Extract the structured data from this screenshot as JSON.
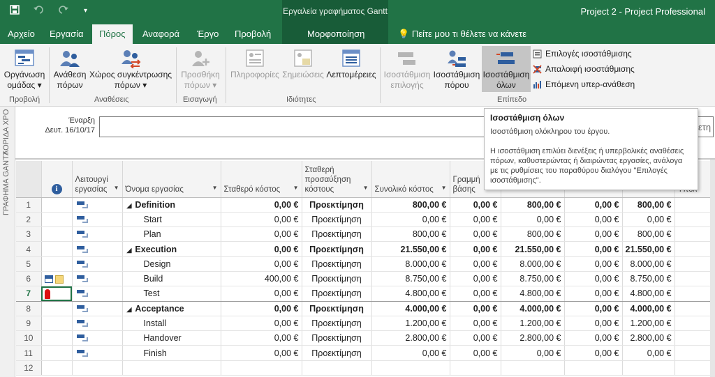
{
  "titlebar": {
    "context_title": "Εργαλεία γραφήματος Gantt",
    "app_title": "Project 2  -  Project Professional",
    "save_icon": "save-icon",
    "undo_icon": "undo-icon",
    "redo_icon": "redo-icon",
    "qat_more": "▾"
  },
  "tabs": {
    "file": "Αρχείο",
    "task": "Εργασία",
    "resource": "Πόρος",
    "report": "Αναφορά",
    "project": "Έργο",
    "view": "Προβολή",
    "format": "Μορφοποίηση",
    "tellme": "Πείτε μου τι θέλετε να κάνετε"
  },
  "ribbon": {
    "team_planner": [
      "Οργάνωση",
      "ομάδας ▾"
    ],
    "assign_resources": [
      "Ανάθεση",
      "πόρων"
    ],
    "resource_pool": [
      "Χώρος συγκέντρωσης",
      "πόρων ▾"
    ],
    "add_resources": [
      "Προσθήκη",
      "πόρων ▾"
    ],
    "information": "Πληροφορίες",
    "notes": "Σημειώσεις",
    "details": "Λεπτομέρειες",
    "level_selection": [
      "Ισοστάθμιση",
      "επιλογής"
    ],
    "level_resource": [
      "Ισοστάθμιση",
      "πόρου"
    ],
    "level_all": [
      "Ισοστάθμιση",
      "όλων"
    ],
    "leveling_options": "Επιλογές ισοστάθμισης",
    "clear_leveling": "Απαλοιφή ισοστάθμισης",
    "next_overallocation": "Επόμενη υπερ-ανάθεση",
    "groups": {
      "view": "Προβολή",
      "assignments": "Αναθέσεις",
      "insert": "Εισαγωγή",
      "properties": "Ιδιότητες",
      "level": "Επίπεδο"
    }
  },
  "timeline": {
    "side_label": "ΛΟΡΙΔΑ ΧΡΟ",
    "start_label": "Έναρξη",
    "start_date": "Δευτ. 16/10/17",
    "right_fragment": "ετη"
  },
  "tooltip": {
    "title": "Ισοστάθμιση όλων",
    "line1": "Ισοστάθμιση ολόκληρου του έργου.",
    "line2": "Η ισοστάθμιση επιλύει διενέξεις ή υπερβολικές αναθέσεις πόρων, καθυστερώντας ή διαιρώντας εργασίες, ανάλογα με τις ρυθμίσεις του παραθύρου διαλόγου \"Επιλογές ισοστάθμισης\"."
  },
  "grid": {
    "side_label": "ΓΡΑΦΗΜΑ GANTT",
    "headers": {
      "info": "i",
      "mode": "Λειτουργί εργασίας",
      "name": "Όνομα εργασίας",
      "fixed_cost": "Σταθερό κόστος",
      "accrual": "Σταθερή προσαύξηση κόστους",
      "total": "Συνολικό κόστος",
      "baseline": "Γραμμή βάσης",
      "col8": "",
      "col9": "",
      "col10": "",
      "col11": "",
      "col12": "Υπόλ"
    },
    "rows": [
      {
        "id": "1",
        "name": "Definition",
        "summary": true,
        "fixed": "0,00 €",
        "accrual": "Προεκτίμηση",
        "total": "800,00 €",
        "baseline": "0,00 €",
        "c8": "800,00 €",
        "c9": "0,00 €",
        "c10": "800,00 €"
      },
      {
        "id": "2",
        "name": "Start",
        "summary": false,
        "fixed": "0,00 €",
        "accrual": "Προεκτίμηση",
        "total": "0,00 €",
        "baseline": "0,00 €",
        "c8": "0,00 €",
        "c9": "0,00 €",
        "c10": "0,00 €"
      },
      {
        "id": "3",
        "name": "Plan",
        "summary": false,
        "fixed": "0,00 €",
        "accrual": "Προεκτίμηση",
        "total": "800,00 €",
        "baseline": "0,00 €",
        "c8": "800,00 €",
        "c9": "0,00 €",
        "c10": "800,00 €"
      },
      {
        "id": "4",
        "name": "Execution",
        "summary": true,
        "fixed": "0,00 €",
        "accrual": "Προεκτίμηση",
        "total": "21.550,00 €",
        "baseline": "0,00 €",
        "c8": "21.550,00 €",
        "c9": "0,00 €",
        "c10": "21.550,00 €"
      },
      {
        "id": "5",
        "name": "Design",
        "summary": false,
        "fixed": "0,00 €",
        "accrual": "Προεκτίμηση",
        "total": "8.000,00 €",
        "baseline": "0,00 €",
        "c8": "8.000,00 €",
        "c9": "0,00 €",
        "c10": "8.000,00 €"
      },
      {
        "id": "6",
        "name": "Build",
        "summary": false,
        "fixed": "400,00 €",
        "accrual": "Προεκτίμηση",
        "total": "8.750,00 €",
        "baseline": "0,00 €",
        "c8": "8.750,00 €",
        "c9": "0,00 €",
        "c10": "8.750,00 €"
      },
      {
        "id": "7",
        "name": "Test",
        "summary": false,
        "fixed": "0,00 €",
        "accrual": "Προεκτίμηση",
        "total": "4.800,00 €",
        "baseline": "0,00 €",
        "c8": "4.800,00 €",
        "c9": "0,00 €",
        "c10": "4.800,00 €"
      },
      {
        "id": "8",
        "name": "Acceptance",
        "summary": true,
        "fixed": "0,00 €",
        "accrual": "Προεκτίμηση",
        "total": "4.000,00 €",
        "baseline": "0,00 €",
        "c8": "4.000,00 €",
        "c9": "0,00 €",
        "c10": "4.000,00 €"
      },
      {
        "id": "9",
        "name": "Install",
        "summary": false,
        "fixed": "0,00 €",
        "accrual": "Προεκτίμηση",
        "total": "1.200,00 €",
        "baseline": "0,00 €",
        "c8": "1.200,00 €",
        "c9": "0,00 €",
        "c10": "1.200,00 €"
      },
      {
        "id": "10",
        "name": "Handover",
        "summary": false,
        "fixed": "0,00 €",
        "accrual": "Προεκτίμηση",
        "total": "2.800,00 €",
        "baseline": "0,00 €",
        "c8": "2.800,00 €",
        "c9": "0,00 €",
        "c10": "2.800,00 €"
      },
      {
        "id": "11",
        "name": "Finish",
        "summary": false,
        "fixed": "0,00 €",
        "accrual": "Προεκτίμηση",
        "total": "0,00 €",
        "baseline": "0,00 €",
        "c8": "0,00 €",
        "c9": "0,00 €",
        "c10": "0,00 €"
      },
      {
        "id": "12",
        "name": "",
        "summary": false,
        "fixed": "",
        "accrual": "",
        "total": "",
        "baseline": "",
        "c8": "",
        "c9": "",
        "c10": ""
      }
    ],
    "selected_row": "7",
    "collapse_glyph": "◢"
  },
  "colors": {
    "accent": "#217346",
    "context": "#185c38",
    "mode_icon": "#2f5e9e"
  }
}
